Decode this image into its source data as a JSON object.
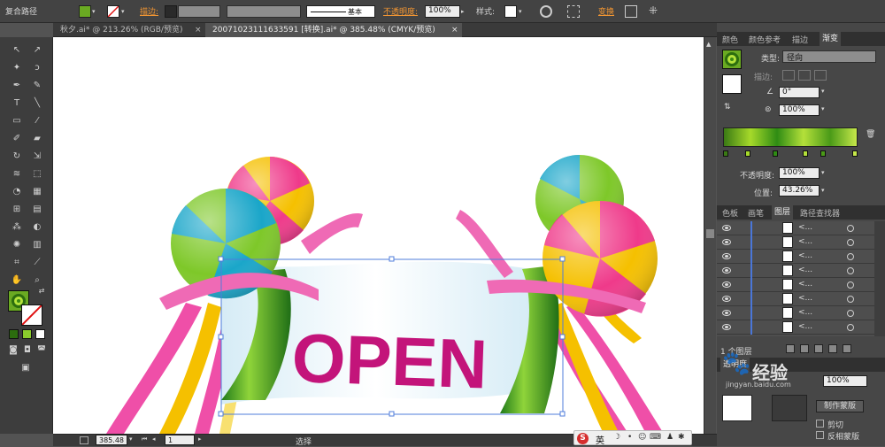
{
  "control_bar": {
    "selection_type": "复合路径",
    "stroke_label": "描边:",
    "stroke_profile": "基本",
    "opacity_label": "不透明度:",
    "opacity_value": "100%",
    "style_label": "样式:",
    "transform_label": "变换"
  },
  "doc_tabs": [
    {
      "label": "秋夕.ai* @ 213.26% (RGB/预览)"
    },
    {
      "label": "20071023111633591 [转换].ai* @ 385.48% (CMYK/预览)"
    }
  ],
  "panel_tabs_top": [
    "颜色",
    "颜色参考",
    "描边",
    "渐变"
  ],
  "gradient": {
    "type_label": "类型:",
    "type_value": "径向",
    "stroke_label": "描边:",
    "angle_value": "0°",
    "aspect_value": "100%",
    "opacity_label": "不透明度:",
    "opacity_value": "100%",
    "position_label": "位置:",
    "position_value": "43.26%",
    "colors": [
      "#3a7a14",
      "#a6d92a",
      "#2f8c14",
      "#b4e03a",
      "#4a9a18",
      "#c6e84a"
    ]
  },
  "panel_tabs_bottom": [
    "色板",
    "画笔",
    "图层",
    "路径查找器"
  ],
  "layers": {
    "rows": 8,
    "row_label": "<...",
    "count_label": "1 个图层"
  },
  "transparency": {
    "tab": "透明度",
    "opacity_value": "100%",
    "make_mask": "制作蒙版",
    "clip": "剪切",
    "invert_mask": "反相蒙版"
  },
  "artwork": {
    "banner_text": "OPEN"
  },
  "status": {
    "zoom": "385.48",
    "page": "1",
    "state": "选择"
  },
  "ime": {
    "lang": "英"
  },
  "watermark": {
    "text": "经验",
    "site": "jingyan.baidu.com"
  },
  "colors": {
    "accent_orange": "#f29633",
    "text_magenta": "#c3147a",
    "ribbon_pink": "#ef4fa8",
    "ribbon_yellow": "#f5c000",
    "ribbon_green": "#3aa020"
  }
}
